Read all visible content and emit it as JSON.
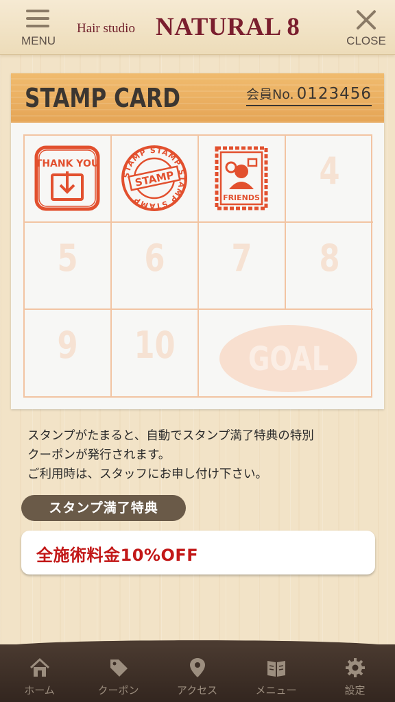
{
  "header": {
    "menu_label": "MENU",
    "brand_small": "Hair studio",
    "brand_big": "NATURAL 8",
    "close_label": "CLOSE"
  },
  "card": {
    "title": "STAMP CARD",
    "member_label": "会員No.",
    "member_no": "0123456",
    "stamps": [
      {
        "type": "thank-you",
        "text": "THANK YOU"
      },
      {
        "type": "round-stamp",
        "text": "STAMP",
        "ring_text": "STAMP STAMP STAMP STAMP"
      },
      {
        "type": "friends",
        "text": "FRIENDS"
      }
    ],
    "empty_cells": [
      "4",
      "5",
      "6",
      "7",
      "8",
      "9",
      "10"
    ],
    "goal": "GOAL"
  },
  "info": {
    "line1": "スタンプがたまると、自動でスタンプ満了特典の特別",
    "line2": "クーポンが発行されます。",
    "line3": "ご利用時は、スタッフにお申し付け下さい。"
  },
  "benefit": {
    "tag": "スタンプ満了特典",
    "text": "全施術料金10%OFF"
  },
  "tabs": [
    {
      "label": "ホーム",
      "icon": "home-icon"
    },
    {
      "label": "クーポン",
      "icon": "coupon-tag-icon"
    },
    {
      "label": "アクセス",
      "icon": "map-pin-icon"
    },
    {
      "label": "メニュー",
      "icon": "menu-book-icon"
    },
    {
      "label": "設定",
      "icon": "gear-icon"
    }
  ],
  "colors": {
    "brand": "#7a1e2e",
    "stamp_red": "#e2502e",
    "grid_line": "#f2c4a2",
    "benefit_red": "#c21818",
    "tabbar": "#3d2f27"
  }
}
